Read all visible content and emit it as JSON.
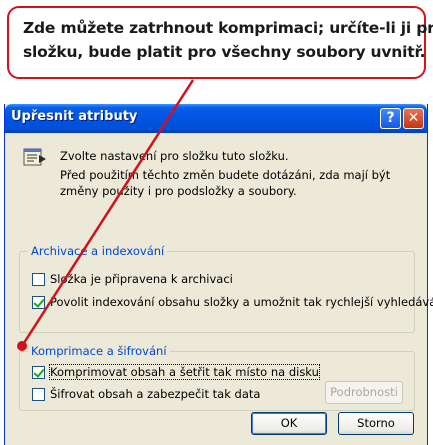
{
  "callout": {
    "line1": "Zde můžete zatrhnout komprimaci; určíte-li ji pro",
    "line2": "složku, bude platit pro všechny soubory uvnitř.",
    "color": "#d2121a"
  },
  "dialog": {
    "title": "Upřesnit atributy",
    "help_label": "?",
    "close_label": "✕",
    "intro_line1": "Zvolte nastavení pro složku tuto složku.",
    "intro_line2": "Před použitím těchto změn budete dotázáni, zda mají být změny použity i pro podsložky a soubory.",
    "icon": "folder-properties-icon"
  },
  "archive_group": {
    "legend": "Archivace a indexování",
    "options": [
      {
        "label": "Složka je připravena k archivaci",
        "checked": false
      },
      {
        "label": "Povolit indexování obsahu složky a umožnit tak rychlejší vyhledávání",
        "checked": true
      }
    ]
  },
  "compress_group": {
    "legend": "Komprimace a šifrování",
    "options": [
      {
        "label": "Komprimovat obsah a šetřit tak místo na disku",
        "checked": true
      },
      {
        "label": "Šifrovat obsah a zabezpečit tak data",
        "checked": false
      }
    ],
    "details_button": "Podrobnosti"
  },
  "buttons": {
    "ok": "OK",
    "cancel": "Storno"
  },
  "colors": {
    "titlebar": "#0054e3",
    "dialog_bg": "#ece9d8",
    "legend_text": "#0046d5"
  }
}
